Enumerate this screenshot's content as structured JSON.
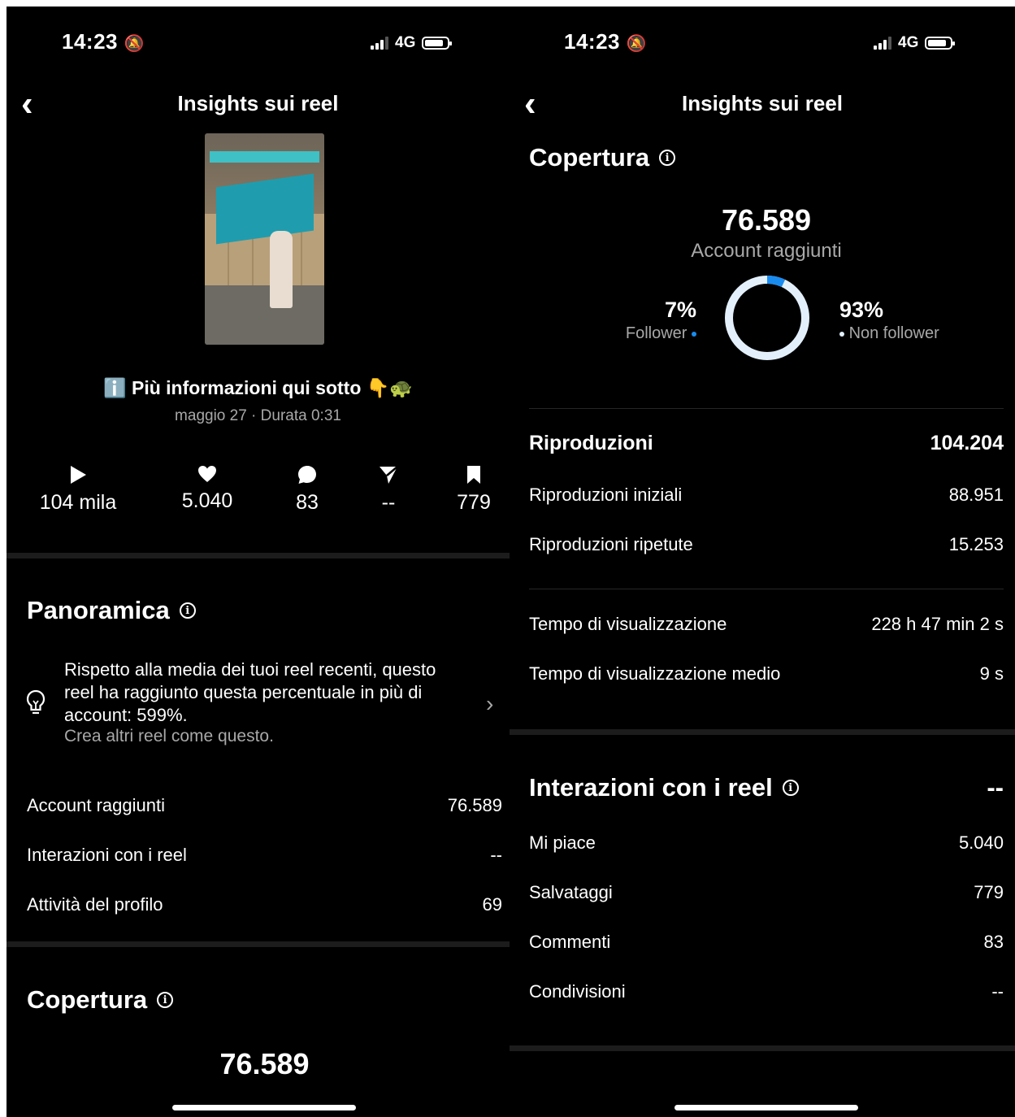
{
  "status": {
    "time": "14:23",
    "network": "4G"
  },
  "nav": {
    "title": "Insights sui reel"
  },
  "reel": {
    "caption": "ℹ️ Più informazioni qui sotto 👇🐢",
    "meta": "maggio 27 · Durata 0:31",
    "stats": [
      {
        "icon": "play-icon",
        "value": "104 mila"
      },
      {
        "icon": "heart-icon",
        "value": "5.040"
      },
      {
        "icon": "comment-icon",
        "value": "83"
      },
      {
        "icon": "share-icon",
        "value": "--"
      },
      {
        "icon": "bookmark-icon",
        "value": "779"
      }
    ]
  },
  "overview": {
    "title": "Panoramica",
    "tip_text": "Rispetto alla media dei tuoi reel recenti, questo reel ha raggiunto questa percentuale in più di account: 599%.",
    "tip_link": "Crea altri reel come questo.",
    "rows": [
      {
        "label": "Account raggiunti",
        "value": "76.589"
      },
      {
        "label": "Interazioni con i reel",
        "value": "--"
      },
      {
        "label": "Attività del profilo",
        "value": "69"
      }
    ]
  },
  "reach": {
    "title": "Copertura",
    "value": "76.589",
    "subtitle": "Account raggiunti",
    "follower_pct": "7%",
    "follower_label": "Follower",
    "nonfollower_pct": "93%",
    "nonfollower_label": "Non follower",
    "follower_fraction": 0.07,
    "colors": {
      "follower": "#1a8cf0",
      "nonfollower": "#e3f0fc"
    }
  },
  "plays": {
    "title": "Riproduzioni",
    "total": "104.204",
    "rows": [
      {
        "label": "Riproduzioni iniziali",
        "value": "88.951"
      },
      {
        "label": "Riproduzioni ripetute",
        "value": "15.253"
      }
    ]
  },
  "watch": {
    "rows": [
      {
        "label": "Tempo di visualizzazione",
        "value": "228 h 47 min 2 s"
      },
      {
        "label": "Tempo di visualizzazione medio",
        "value": "9 s"
      }
    ]
  },
  "interactions": {
    "title": "Interazioni con i reel",
    "total": "--",
    "rows": [
      {
        "label": "Mi piace",
        "value": "5.040"
      },
      {
        "label": "Salvataggi",
        "value": "779"
      },
      {
        "label": "Commenti",
        "value": "83"
      },
      {
        "label": "Condivisioni",
        "value": "--"
      }
    ]
  }
}
